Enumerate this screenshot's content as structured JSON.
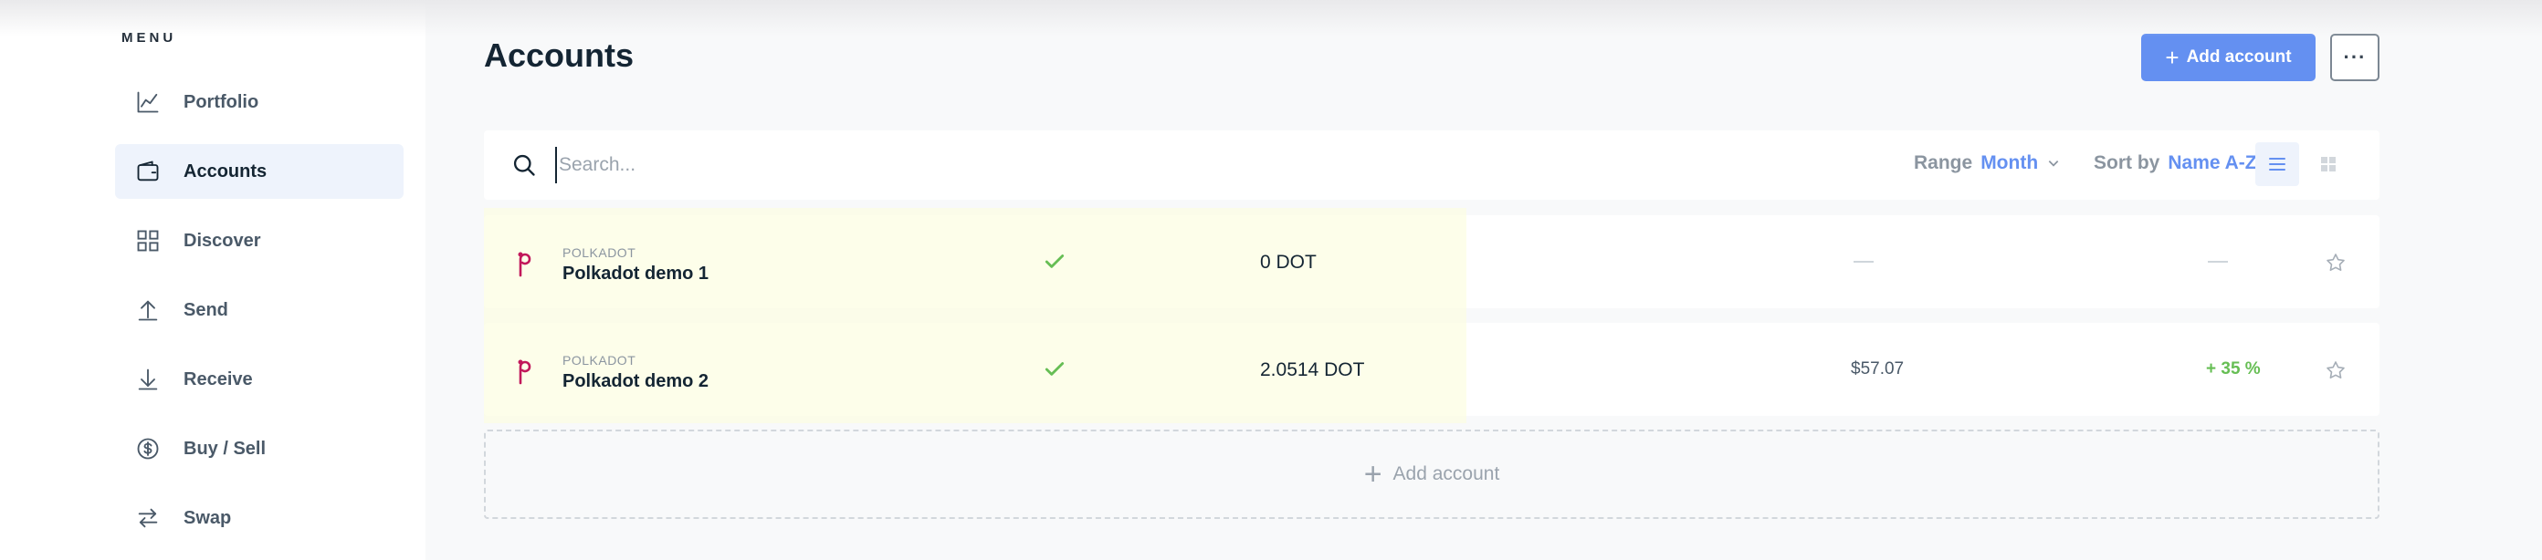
{
  "sidebar": {
    "menu_title": "MENU",
    "items": [
      {
        "label": "Portfolio",
        "icon": "chart-line-icon",
        "active": false
      },
      {
        "label": "Accounts",
        "icon": "wallet-icon",
        "active": true
      },
      {
        "label": "Discover",
        "icon": "grid-icon",
        "active": false
      },
      {
        "label": "Send",
        "icon": "arrow-up-icon",
        "active": false
      },
      {
        "label": "Receive",
        "icon": "arrow-down-icon",
        "active": false
      },
      {
        "label": "Buy / Sell",
        "icon": "dollar-circle-icon",
        "active": false
      },
      {
        "label": "Swap",
        "icon": "swap-arrows-icon",
        "active": false
      }
    ]
  },
  "header": {
    "title": "Accounts",
    "add_button_label": "Add account",
    "more_label": "···"
  },
  "toolbar": {
    "search_placeholder": "Search...",
    "range_key": "Range",
    "range_value": "Month",
    "sort_key": "Sort by",
    "sort_value": "Name A-Z"
  },
  "accounts": [
    {
      "currency": "POLKADOT",
      "name": "Polkadot demo 1",
      "synced": true,
      "balance": "0 DOT",
      "fiat": "",
      "change": ""
    },
    {
      "currency": "POLKADOT",
      "name": "Polkadot demo 2",
      "synced": true,
      "balance": "2.0514 DOT",
      "fiat": "$57.07",
      "change": "+ 35 %"
    }
  ],
  "footer": {
    "add_account_label": "Add account"
  },
  "colors": {
    "accent": "#6490f1",
    "positive": "#66be54",
    "polkadot": "#e6007a"
  }
}
